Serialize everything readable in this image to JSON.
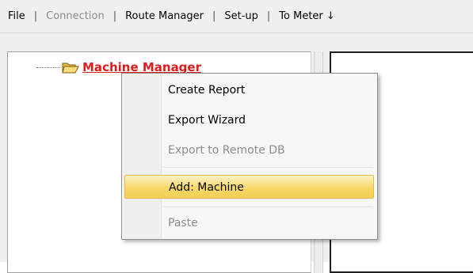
{
  "menubar": {
    "items": [
      {
        "label": "File",
        "disabled": false
      },
      {
        "label": "Connection",
        "disabled": true
      },
      {
        "label": "Route Manager",
        "disabled": false
      },
      {
        "label": "Set-up",
        "disabled": false
      },
      {
        "label": "To Meter ↓",
        "disabled": false
      }
    ],
    "separator": "|"
  },
  "tree": {
    "root": {
      "label": "Machine Manager",
      "icon": "folder-open-icon",
      "color": "#e01b1b"
    }
  },
  "context_menu": {
    "items": [
      {
        "label": "Create Report",
        "disabled": false
      },
      {
        "label": "Export Wizard",
        "disabled": false
      },
      {
        "label": "Export to Remote DB",
        "disabled": true
      },
      {
        "label": "Add: Machine",
        "disabled": false,
        "highlighted": true
      },
      {
        "label": "Paste",
        "disabled": true
      }
    ],
    "highlight_color": "#f8d866"
  }
}
